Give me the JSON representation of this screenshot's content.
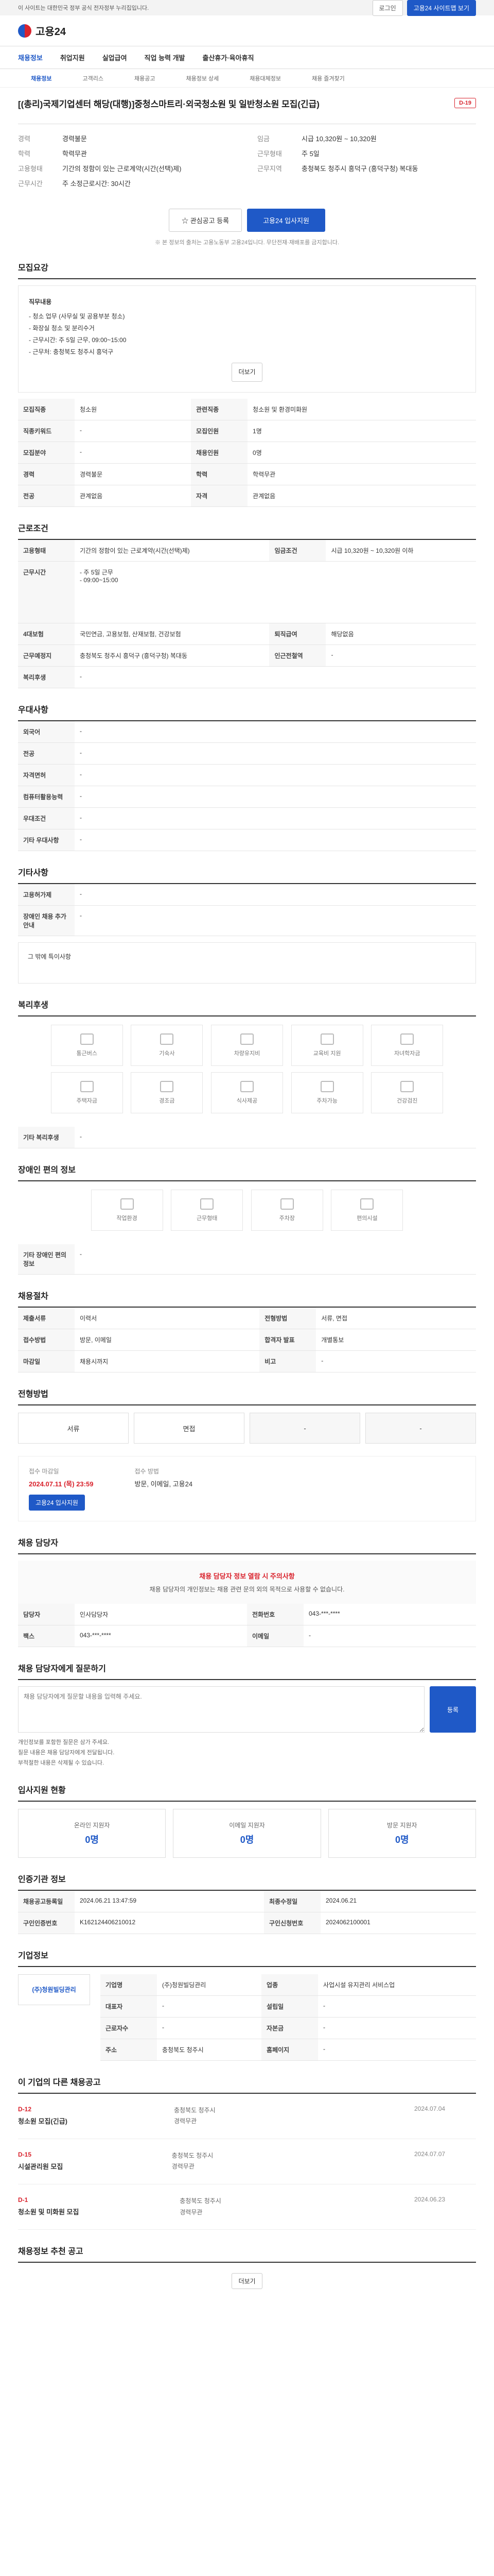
{
  "topbar": {
    "notice": "이 사이트는 대한민국 정부 공식 전자정부 누리집입니다.",
    "login": "로그인",
    "mobile": "웹",
    "full": "고용24 사이트맵 보기"
  },
  "logo": {
    "text": "고용24"
  },
  "nav": {
    "items": [
      "채용정보",
      "취업지원",
      "실업급여",
      "직업 능력 개발",
      "출산휴가·육아휴직"
    ]
  },
  "subnav": {
    "items": [
      "채용정보",
      "고객리스",
      "채용공고",
      "채용정보 상세",
      "채용대체정보",
      "채용 즐겨찾기"
    ]
  },
  "job": {
    "badge": "D-19",
    "title": "[(총리)국제기업센터 해당(대행)]중청스마트리·외국청소원 및 일반청소원 모집(긴급)",
    "summary": [
      [
        "경력",
        "경력불문"
      ],
      [
        "학력",
        "학력무관"
      ],
      [
        "임금",
        "시급 10,320원 ~ 10,320원"
      ],
      [
        "근무형태",
        "주 5일"
      ],
      [
        "근무지역",
        "충청북도 청주시 흥덕구 (흥덕구청) 복대동"
      ],
      [
        "고용형태",
        "기간의 정함이 있는 근로계약(시간(선택)제)"
      ],
      [
        "근무시간",
        "주 소정근로시간: 30시간"
      ]
    ],
    "interest": "관심공고 등록",
    "apply": "고용24 입사지원",
    "caution": "※ 본 정보의 출처는 고용노동부 고용24입니다. 무단전재·재배포를 금지합니다."
  },
  "recruit": {
    "title": "모집요강",
    "body_title": "직무내용",
    "lines": [
      "- 청소 업무 (사무실 및 공용부분 청소)",
      "- 화장실 청소 및 분리수거",
      "- 근무시간: 주 5일 근무, 09:00~15:00",
      "- 근무처: 충청북도 청주시 흥덕구"
    ],
    "more": "더보기",
    "rows": [
      [
        "모집직종",
        "청소원",
        "관련직종",
        "청소원 및 환경미화원"
      ],
      [
        "직종키워드",
        "-",
        "모집인원",
        "1명"
      ],
      [
        "모집분야",
        "-",
        "채용인원",
        "0명"
      ],
      [
        "경력",
        "경력불문",
        "학력",
        "학력무관"
      ],
      [
        "전공",
        "관계없음",
        "자격",
        "관계없음"
      ]
    ]
  },
  "cond": {
    "title": "근로조건",
    "rows": [
      [
        "고용형태",
        "기간의 정함이 있는 근로계약(시간(선택)제)",
        "임금조건",
        "시급 10,320원 ~ 10,320원 이하"
      ],
      [
        "근무시간",
        "- 주 5일 근무\n- 09:00~15:00",
        "",
        ""
      ],
      [
        "4대보험",
        "국민연금, 고용보험, 산재보험, 건강보험",
        "퇴직급여",
        "해당없음"
      ],
      [
        "근무예정지",
        "충청북도 청주시 흥덕구 (흥덕구청) 복대동",
        "인근전철역",
        "-"
      ],
      [
        "복리후생",
        "-",
        "",
        ""
      ]
    ]
  },
  "prefer": {
    "title": "우대사항",
    "rows": [
      [
        "외국어",
        "-"
      ],
      [
        "전공",
        "-"
      ],
      [
        "자격면허",
        "-"
      ],
      [
        "컴퓨터활용능력",
        "-"
      ],
      [
        "우대조건",
        "-"
      ],
      [
        "기타 우대사항",
        "-"
      ]
    ]
  },
  "etc": {
    "title": "기타사항",
    "rows": [
      [
        "고용허가제",
        "-"
      ],
      [
        "장애인 채용 추가 안내",
        "-"
      ]
    ],
    "note": "그 밖에 특이사항"
  },
  "welfare": {
    "title": "복리후생",
    "items": [
      "통근버스",
      "기숙사",
      "차량유지비",
      "교육비 지원",
      "자녀학자금",
      "주택자금",
      "경조금",
      "식사제공",
      "주차가능",
      "건강검진"
    ],
    "extra_title": "기타 복리후생",
    "extra": "-"
  },
  "disabled": {
    "title": "장애인 편의 정보",
    "items": [
      "작업환경",
      "근무형태",
      "주차장",
      "편의시설"
    ],
    "extra_title": "기타 장애인 편의 정보",
    "extra": "-"
  },
  "process": {
    "title": "채용절차",
    "rows": [
      [
        "제출서류",
        "이력서"
      ],
      [
        "전형방법",
        "서류, 면접"
      ],
      [
        "접수방법",
        "방문, 이메일"
      ],
      [
        "합격자 발표",
        "개별통보"
      ],
      [
        "마감일",
        "채용시까지"
      ],
      [
        "비고",
        "-"
      ]
    ]
  },
  "howapply": {
    "title": "전형방법",
    "steps": [
      "서류",
      "면접",
      "-",
      "-"
    ],
    "reg_label": "접수 마감일",
    "reg_date": "2024.07.11 (목) 23:59",
    "ptype_label": "접수 방법",
    "ptype": "방문, 이메일, 고용24",
    "btn": "고용24 입사지원"
  },
  "contact": {
    "title": "채용 담당자",
    "warn": "채용 담당자 정보 열람 시 주의사항",
    "text": "채용 담당자의 개인정보는 채용 관련 문의 외의 목적으로 사용할 수 없습니다.",
    "name_label": "담당자",
    "name": "인사담당자",
    "tel_label": "전화번호",
    "tel": "043-***-****",
    "fax_label": "팩스",
    "fax": "043-***-****",
    "email_label": "이메일",
    "email": "-"
  },
  "qna": {
    "title": "채용 담당자에게 질문하기",
    "placeholder": "채용 담당자에게 질문할 내용을 입력해 주세요.",
    "btn": "등록",
    "notes": [
      "개인정보를 포함한 질문은 삼가 주세요.",
      "질문 내용은 채용 담당자에게 전달됩니다.",
      "부적절한 내용은 삭제될 수 있습니다."
    ]
  },
  "stats": {
    "title": "입사지원 현황",
    "items": [
      [
        "온라인 지원자",
        "0명"
      ],
      [
        "이메일 지원자",
        "0명"
      ],
      [
        "방문 지원자",
        "0명"
      ]
    ]
  },
  "agency": {
    "title": "인증기관 정보",
    "rows": [
      [
        "채용공고등록일",
        "2024.06.21 13:47:59",
        "최종수정일",
        "2024.06.21"
      ],
      [
        "구인인증번호",
        "K162124406210012",
        "구인신청번호",
        "2024062100001"
      ]
    ]
  },
  "company": {
    "title": "기업정보",
    "name": "(주)청원빌딩관리",
    "rows": [
      [
        "기업명",
        "(주)청원빌딩관리",
        "업종",
        "사업시설 유지관리 서비스업"
      ],
      [
        "대표자",
        "-",
        "설립일",
        "-"
      ],
      [
        "근로자수",
        "-",
        "자본금",
        "-"
      ],
      [
        "주소",
        "충청북도 청주시",
        "홈페이지",
        "-"
      ]
    ]
  },
  "related": {
    "title": "이 기업의 다른 채용공고",
    "items": [
      [
        "D-12",
        "청소원 모집(긴급)",
        "충청북도 청주시",
        "경력무관",
        "2024.07.04"
      ],
      [
        "D-15",
        "시설관리원 모집",
        "충청북도 청주시",
        "경력무관",
        "2024.07.07"
      ],
      [
        "D-1",
        "청소원 및 미화원 모집",
        "충청북도 청주시",
        "경력무관",
        "2024.06.23"
      ]
    ]
  },
  "footer": {
    "title": "채용정보 추천 공고",
    "more": "더보기"
  }
}
